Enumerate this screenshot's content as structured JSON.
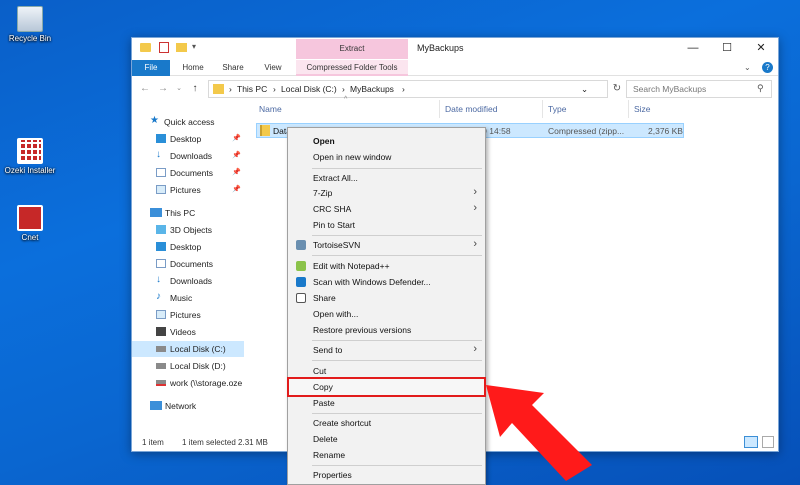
{
  "desktop": {
    "icons": [
      {
        "label": "Recycle Bin",
        "icon": "recycle-bin-icon"
      },
      {
        "label": "Ozeki Installer",
        "icon": "installer-icon"
      },
      {
        "label": "Cnet",
        "icon": "cnet-icon"
      }
    ]
  },
  "window": {
    "title": "MyBackups",
    "contextual_tab_group": "Extract",
    "controls": {
      "minimize": "—",
      "maximize": "☐",
      "close": "✕"
    }
  },
  "ribbon": {
    "tabs": [
      "File",
      "Home",
      "Share",
      "View",
      "Compressed Folder Tools"
    ]
  },
  "address": {
    "crumbs": [
      "This PC",
      "Local Disk (C:)",
      "MyBackups"
    ],
    "search_placeholder": "Search MyBackups"
  },
  "nav_pane": {
    "quick_access_label": "Quick access",
    "quick_access": [
      "Desktop",
      "Downloads",
      "Documents",
      "Pictures"
    ],
    "this_pc_label": "This PC",
    "this_pc": [
      "3D Objects",
      "Desktop",
      "Documents",
      "Downloads",
      "Music",
      "Pictures",
      "Videos",
      "Local Disk (C:)",
      "Local Disk (D:)",
      "work (\\\\storage.oze"
    ],
    "network_label": "Network"
  },
  "file_list": {
    "columns": [
      "Name",
      "Date modified",
      "Type",
      "Size"
    ],
    "rows": [
      {
        "name": "Data",
        "date": "10/11/2019 14:58",
        "type": "Compressed (zipp...",
        "size": "2,376 KB"
      }
    ]
  },
  "status_bar": {
    "items_count": "1 item",
    "selection": "1 item selected  2.31 MB"
  },
  "context_menu": {
    "items": [
      "Open",
      "Open in new window",
      "Extract All...",
      "7-Zip",
      "CRC SHA",
      "Pin to Start",
      "TortoiseSVN",
      "Edit with Notepad++",
      "Scan with Windows Defender...",
      "Share",
      "Open with...",
      "Restore previous versions",
      "Send to",
      "Cut",
      "Copy",
      "Paste",
      "Create shortcut",
      "Delete",
      "Rename",
      "Properties"
    ],
    "highlighted": "Copy"
  },
  "colors": {
    "accent": "#1979ca",
    "selection": "#cce8ff",
    "highlight_box": "#e21b1b",
    "pointer_arrow": "#ff1a1a"
  }
}
